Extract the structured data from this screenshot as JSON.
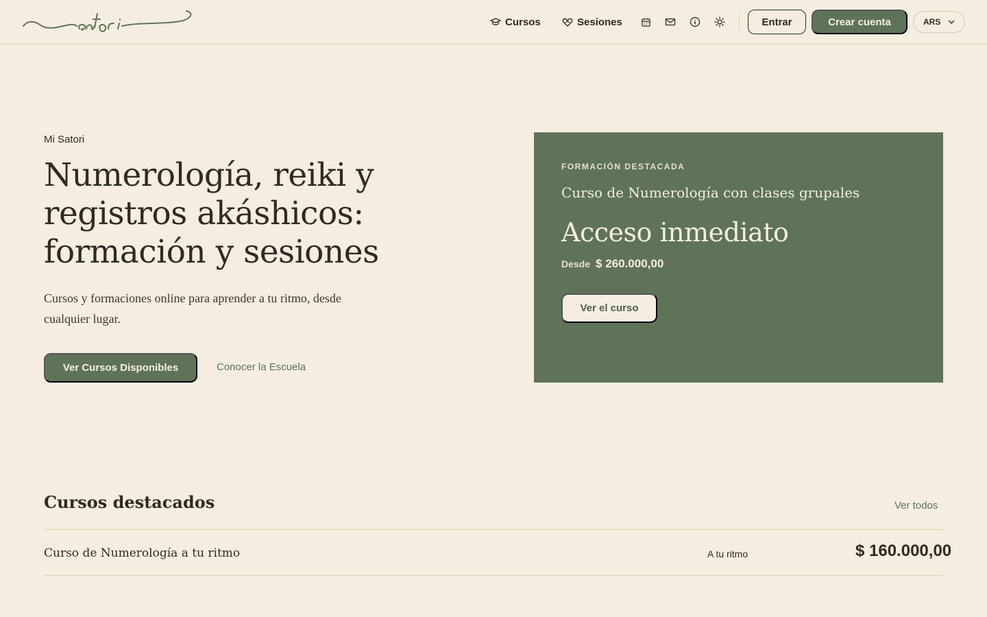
{
  "brand": {
    "logo_text": "satori",
    "accent": "#5f7358",
    "background": "#f5eee0"
  },
  "header": {
    "nav": [
      {
        "label": "Cursos",
        "icon": "graduation-cap-icon"
      },
      {
        "label": "Sesiones",
        "icon": "heart-hand-icon"
      }
    ],
    "icons": [
      "calendar-icon",
      "mail-icon",
      "info-icon",
      "sun-icon"
    ],
    "login_label": "Entrar",
    "signup_label": "Crear cuenta",
    "currency": "ARS"
  },
  "hero": {
    "eyebrow": "Mi Satori",
    "title": "Numerología, reiki y registros akáshicos: formación y sesiones",
    "subtitle": "Cursos y formaciones online para aprender a tu ritmo, desde cualquier lugar.",
    "primary_cta": "Ver Cursos Disponibles",
    "secondary_cta": "Conocer la Escuela"
  },
  "featured": {
    "eyebrow": "FORMACIÓN DESTACADA",
    "course": "Curso de Numerología con clases grupales",
    "headline": "Acceso inmediato",
    "from_label": "Desde",
    "price": "$ 260.000,00",
    "cta": "Ver el curso"
  },
  "courses": {
    "title": "Cursos destacados",
    "see_all": "Ver todos",
    "items": [
      {
        "name": "Curso de Numerología a tu ritmo",
        "mode": "A tu ritmo",
        "price": "$ 160.000,00"
      }
    ]
  }
}
